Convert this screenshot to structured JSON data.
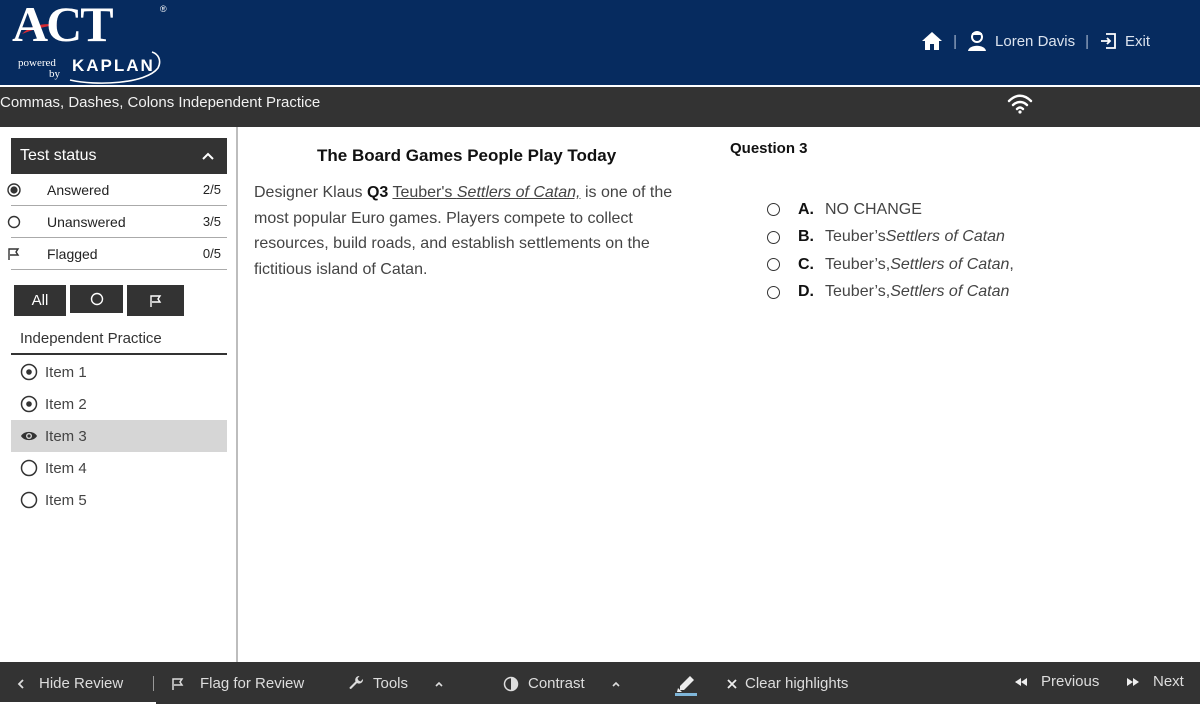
{
  "brand": {
    "logo_text": "ACT",
    "registered_mark": "®",
    "powered_by": "powered",
    "powered_by_by": "by",
    "partner": "KAPLAN"
  },
  "topnav": {
    "home_icon": "home-icon",
    "user_icon": "user-icon",
    "user_name": "Loren Davis",
    "exit_icon": "exit-icon",
    "exit_label": "Exit",
    "separator": "|"
  },
  "titlebar": {
    "title": "Commas, Dashes, Colons Independent Practice",
    "wifi_icon": "wifi-icon"
  },
  "sidebar": {
    "status_header": "Test status",
    "status": [
      {
        "label": "Answered",
        "count": "2/5",
        "icon": "filled-radio-icon"
      },
      {
        "label": "Unanswered",
        "count": "3/5",
        "icon": "empty-radio-icon"
      },
      {
        "label": "Flagged",
        "count": "0/5",
        "icon": "flag-icon"
      }
    ],
    "filters": {
      "all_label": "All"
    },
    "section_title": "Independent Practice",
    "items": [
      {
        "label": "Item 1",
        "state": "answered"
      },
      {
        "label": "Item 2",
        "state": "answered"
      },
      {
        "label": "Item 3",
        "state": "current"
      },
      {
        "label": "Item 4",
        "state": "unanswered"
      },
      {
        "label": "Item 5",
        "state": "unanswered"
      }
    ]
  },
  "passage": {
    "title": "The Board Games People Play Today",
    "text_before": "Designer Klaus ",
    "question_label": "Q3",
    "underlined_plain": "Teuber's ",
    "underlined_italic": "Settlers of Catan,",
    "text_after": " is one of the most popular Euro games. Players compete to collect resources, build roads, and establish settlements on the fictitious island of Catan."
  },
  "question": {
    "title": "Question 3",
    "answers": [
      {
        "letter": "A.",
        "plain": "NO CHANGE",
        "italic": "",
        "tail": ""
      },
      {
        "letter": "B.",
        "plain": "Teuber’s ",
        "italic": "Settlers of Catan",
        "tail": ""
      },
      {
        "letter": "C.",
        "plain": "Teuber’s, ",
        "italic": "Settlers of Catan",
        "tail": ","
      },
      {
        "letter": "D.",
        "plain": "Teuber’s, ",
        "italic": "Settlers of Catan",
        "tail": ""
      }
    ]
  },
  "footer": {
    "hide_review": "Hide Review",
    "flag_for_review": "Flag for Review",
    "tools": "Tools",
    "contrast": "Contrast",
    "clear_highlights": "Clear highlights",
    "previous": "Previous",
    "next": "Next"
  },
  "colors": {
    "header_bg": "#062b5f",
    "bar_bg": "#333333",
    "active_item_bg": "#d6d6d6",
    "highlighter_accent": "#7fb6d9"
  }
}
